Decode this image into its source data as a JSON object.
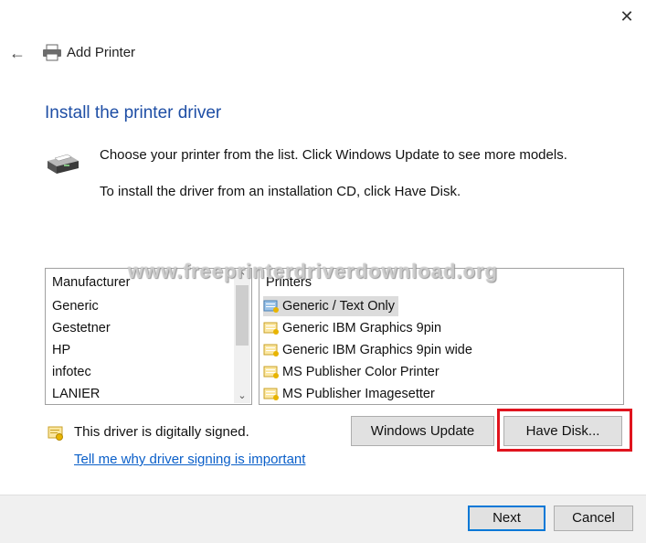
{
  "window": {
    "title": "Add Printer",
    "close_icon": "close-icon",
    "back_icon": "back-arrow-icon"
  },
  "page": {
    "heading": "Install the printer driver",
    "instruction_line1": "Choose your printer from the list. Click Windows Update to see more models.",
    "instruction_line2": "To install the driver from an installation CD, click Have Disk."
  },
  "manufacturers": {
    "header": "Manufacturer",
    "items": [
      "Generic",
      "Gestetner",
      "HP",
      "infotec",
      "LANIER"
    ]
  },
  "printers": {
    "header": "Printers",
    "selected_index": 0,
    "items": [
      "Generic / Text Only",
      "Generic IBM Graphics 9pin",
      "Generic IBM Graphics 9pin wide",
      "MS Publisher Color Printer",
      "MS Publisher Imagesetter"
    ]
  },
  "watermark": "www.freeprinterdriverdownload.org",
  "signing": {
    "status": "This driver is digitally signed.",
    "link": "Tell me why driver signing is important"
  },
  "buttons": {
    "windows_update": "Windows Update",
    "have_disk": "Have Disk...",
    "next": "Next",
    "cancel": "Cancel"
  },
  "colors": {
    "heading": "#1e4ea5",
    "link": "#0a5fc9",
    "highlight": "#e0141e",
    "primary_border": "#0078d7"
  }
}
